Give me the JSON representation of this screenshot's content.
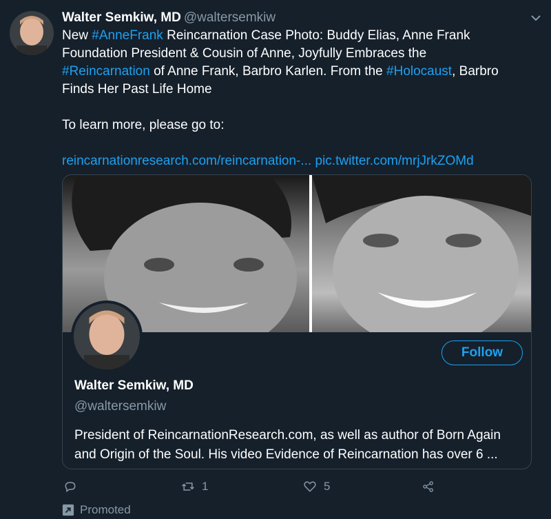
{
  "tweet": {
    "author_name": "Walter Semkiw, MD",
    "author_handle": "@waltersemkiw",
    "text_lines": [
      [
        {
          "t": "New "
        },
        {
          "t": "#AnneFrank",
          "link": true
        },
        {
          "t": " Reincarnation Case Photo: Buddy Elias, Anne Frank"
        }
      ],
      [
        {
          "t": "Foundation President & Cousin of Anne, Joyfully Embraces the"
        }
      ],
      [
        {
          "t": "#Reincarnation",
          "link": true
        },
        {
          "t": " of Anne Frank, Barbro Karlen. From the "
        },
        {
          "t": "#Holocaust",
          "link": true
        },
        {
          "t": ", Barbro"
        }
      ],
      [
        {
          "t": "Finds Her Past Life Home"
        }
      ]
    ],
    "learn_more": "To learn more, please go to:",
    "url_link": "reincarnationresearch.com/reincarnation-...",
    "pic_link": "pic.twitter.com/mrjJrkZOMd"
  },
  "card": {
    "follow_label": "Follow",
    "name": "Walter Semkiw, MD",
    "handle": "@waltersemkiw",
    "bio_line1": "President of ReincarnationResearch.com, as well as author of Born Again",
    "bio_line2": "and Origin of the Soul. His video Evidence of Reincarnation has over 6 ..."
  },
  "actions": {
    "reply_icon": "reply-icon",
    "retweet_count": "1",
    "like_count": "5",
    "share_icon": "share-icon"
  },
  "promoted_label": "Promoted",
  "colors": {
    "background": "#15202b",
    "accent": "#1da1f2",
    "secondary_text": "#8899a6",
    "border": "#38444d"
  }
}
